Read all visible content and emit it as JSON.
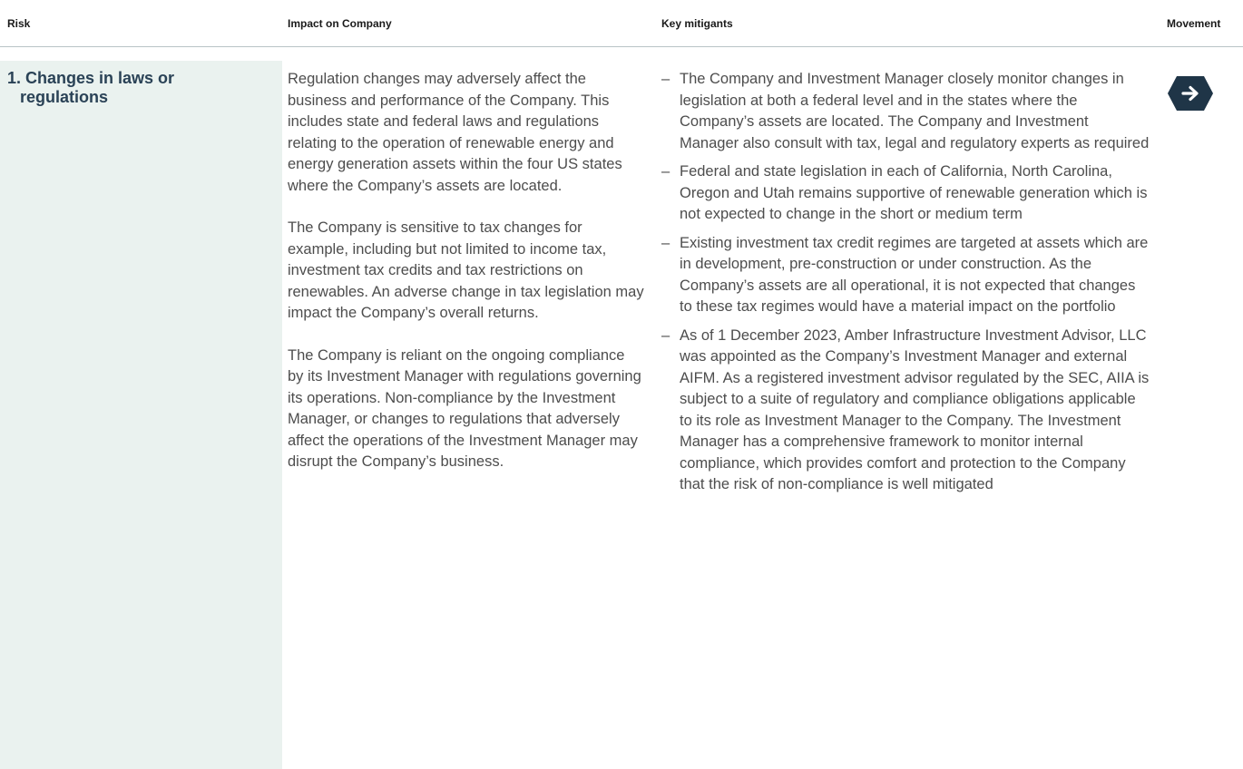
{
  "table": {
    "headers": {
      "risk": "Risk",
      "impact": "Impact on Company",
      "mitigants": "Key mitigants",
      "movement": "Movement"
    },
    "row": {
      "risk_title_line1": "1. Changes in laws or",
      "risk_title_line2": "regulations",
      "impact_paragraphs": [
        "Regulation changes may adversely affect the business and performance of the Company. This includes state and federal laws and regulations relating to the operation of renewable energy and energy generation assets within the four US states where the Company’s assets are located.",
        "The Company is sensitive to tax changes for example, including but not limited to income tax, investment tax credits and tax restrictions on renewables. An adverse change in tax legislation may impact the Company’s overall returns.",
        "The Company is reliant on the ongoing compliance by its Investment Manager with regulations governing its operations. Non-compliance by the Investment Manager, or changes to regulations that adversely affect the operations of the Investment Manager may disrupt the Company’s business."
      ],
      "mitigant_marker": "–",
      "mitigants": [
        "The Company and Investment Manager closely monitor changes in legislation at both a federal level and in the states where the Company’s assets are located. The Company and Investment Manager also consult with tax, legal and regulatory experts as required",
        "Federal and state legislation in each of California, North Carolina, Oregon and Utah remains supportive of renewable generation which is not expected to change in the short or medium term",
        "Existing investment tax credit regimes are targeted at assets which are in development, pre-construction or under construction. As the Company’s assets are all operational, it is not expected that changes to these tax regimes would have a material impact on the portfolio",
        "As of 1 December 2023, Amber Infrastructure Investment Advisor, LLC was appointed as the Company’s Investment Manager and external AIFM. As a registered investment advisor regulated by the SEC, AIIA is subject to a suite of regulatory and compliance obligations applicable to its role as Investment Manager to the Company. The Investment Manager has a comprehensive framework to monitor internal compliance, which provides comfort and protection to the Company that the risk of non-compliance is well mitigated"
      ],
      "movement_icon": "arrow-right-hexagon-icon"
    }
  },
  "colors": {
    "header_text": "#1a1a1a",
    "title_text": "#2a4256",
    "body_text": "#4d4d4d",
    "risk_panel_bg": "#eaf2ef",
    "icon_bg": "#1f3547",
    "rule": "#b9c3c6"
  }
}
